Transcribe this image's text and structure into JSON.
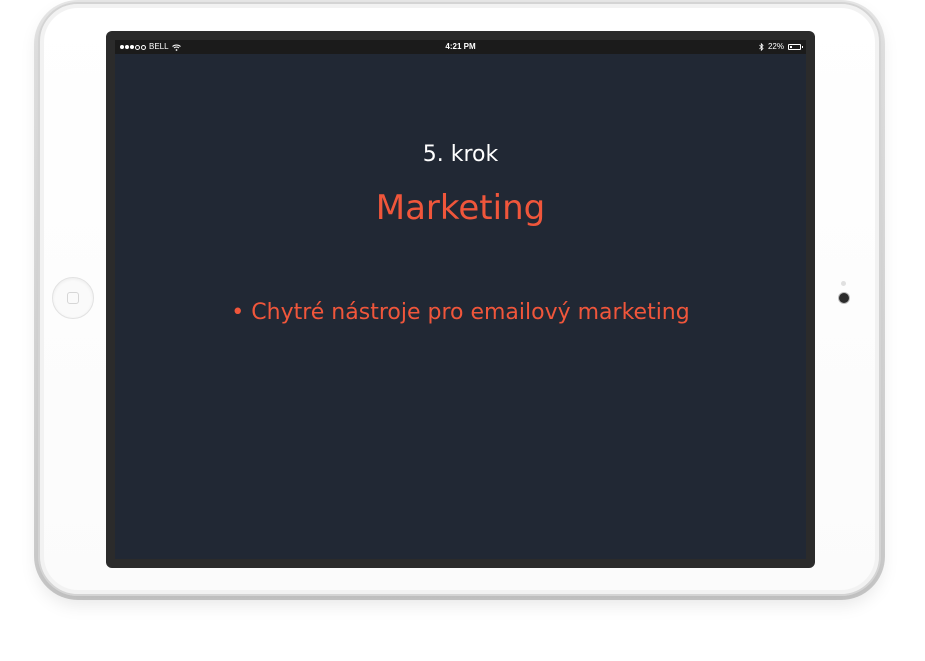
{
  "statusbar": {
    "carrier": "BELL",
    "signal_bars": 3,
    "signal_total": 5,
    "time": "4:21 PM",
    "battery_percent_label": "22%",
    "battery_level": 0.22
  },
  "slide": {
    "step_label": "5. krok",
    "title": "Marketing",
    "bullet_glyph": "•",
    "bullet_text": "Chytré nástroje pro emailový marketing"
  },
  "colors": {
    "screen_background": "#212834",
    "accent": "#f0563b",
    "text_primary": "#ffffff"
  },
  "icons": [
    "wifi-icon",
    "bluetooth-icon",
    "battery-icon",
    "home-button-icon",
    "front-camera-icon"
  ]
}
